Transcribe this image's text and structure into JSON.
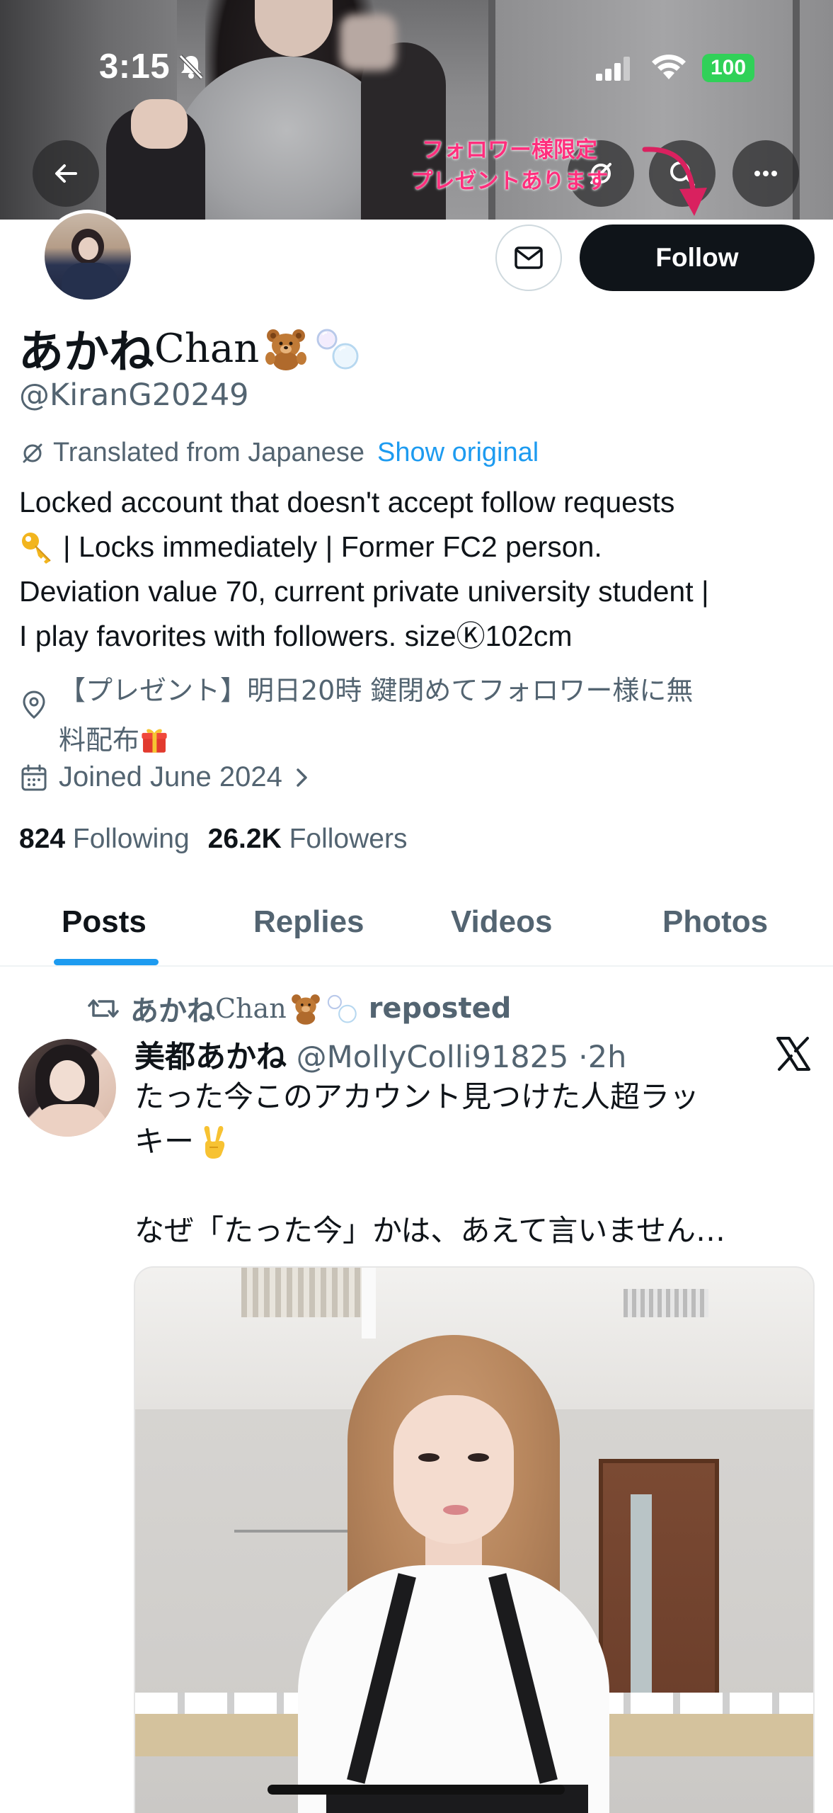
{
  "status_bar": {
    "time": "3:15",
    "battery": "100",
    "battery_color": "#30d158"
  },
  "banner": {
    "promo_text_line1": "フォロワー様限定",
    "promo_text_line2": "プレゼントあります",
    "promo_color": "#ff2f7d"
  },
  "header_actions": {
    "back_icon": "arrow-left-icon",
    "grok_icon": "grok-slash-icon",
    "search_icon": "search-icon",
    "more_icon": "more-horizontal-icon"
  },
  "profile": {
    "message_icon": "envelope-icon",
    "follow_label": "Follow",
    "display_name_jp": "あかね",
    "display_name_en": "Chan",
    "display_name_emojis": [
      "teddy-bear-icon",
      "bubbles-icon"
    ],
    "handle": "@KiranG20249",
    "translated_label": "Translated from Japanese",
    "show_original_label": "Show original",
    "bio": {
      "line1": "Locked account that doesn't accept follow requests",
      "line2": "| Locks immediately | Former FC2 person.",
      "line3": "Deviation value 70, current private university student |",
      "line4": "I play favorites with followers. sizeⓀ102cm"
    },
    "location": {
      "line1": "【プレゼント】明日20時 鍵閉めてフォロワー様に無",
      "line2": "料配布"
    },
    "joined": "Joined June 2024",
    "following_count": "824",
    "following_label": "Following",
    "followers_count": "26.2K",
    "followers_label": "Followers"
  },
  "tabs": [
    {
      "label": "Posts",
      "active": true
    },
    {
      "label": "Replies",
      "active": false
    },
    {
      "label": "Videos",
      "active": false
    },
    {
      "label": "Photos",
      "active": false
    }
  ],
  "accent_color": "#1d9bf0",
  "post": {
    "repost_by_jp": "あかね",
    "repost_by_en": "Chan",
    "repost_label": "reposted",
    "author_name": "美都あかね",
    "author_handle": "@MollyColli91825",
    "separator": "·",
    "time": "2h",
    "platform_icon": "x-logo-icon",
    "text_line1": "たった今このアカウント見つけた人超ラッ",
    "text_line2": "キー",
    "text_line3": "なぜ「たった今」かは、あえて言いません…"
  }
}
